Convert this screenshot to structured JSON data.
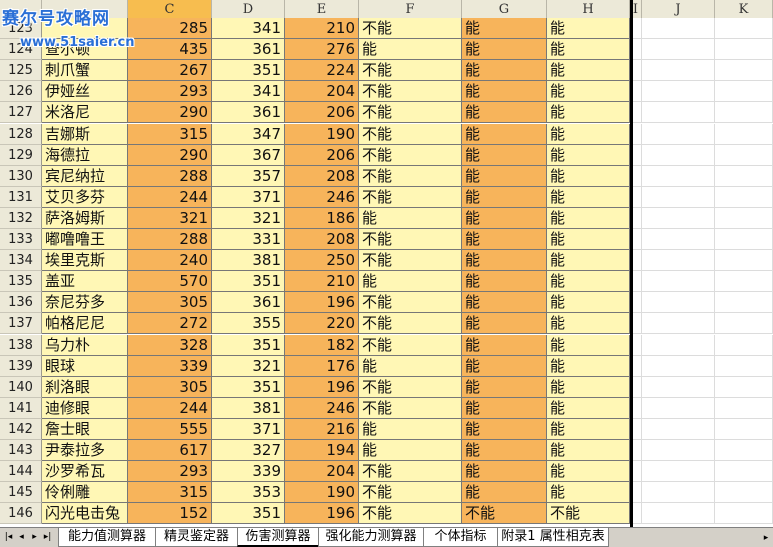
{
  "watermark": {
    "line1": "赛尔号攻略网",
    "line2": "www.51saier.cn"
  },
  "columns": [
    "C",
    "D",
    "E",
    "F",
    "G",
    "H",
    "I",
    "J",
    "K"
  ],
  "colors": {
    "name_col": "#fff7b5",
    "c_col": "#f7b45b",
    "d_col": "#fff7b5",
    "e_col": "#f7b45b",
    "f_col": "#fff7b5",
    "g_col": "#f7b45b",
    "h_col": "#fff7b5"
  },
  "rows": [
    {
      "num": "123",
      "name": "",
      "c": "285",
      "d": "341",
      "e": "210",
      "f": "不能",
      "g": "能",
      "h": "能"
    },
    {
      "num": "124",
      "name": "查尔顿",
      "c": "435",
      "d": "361",
      "e": "276",
      "f": "能",
      "g": "能",
      "h": "能"
    },
    {
      "num": "125",
      "name": "刺爪蟹",
      "c": "267",
      "d": "351",
      "e": "224",
      "f": "不能",
      "g": "能",
      "h": "能"
    },
    {
      "num": "126",
      "name": "伊娅丝",
      "c": "293",
      "d": "341",
      "e": "204",
      "f": "不能",
      "g": "能",
      "h": "能"
    },
    {
      "num": "127",
      "name": "米洛尼",
      "c": "290",
      "d": "361",
      "e": "206",
      "f": "不能",
      "g": "能",
      "h": "能"
    },
    {
      "num": "128",
      "name": "吉娜斯",
      "c": "315",
      "d": "347",
      "e": "190",
      "f": "不能",
      "g": "能",
      "h": "能"
    },
    {
      "num": "129",
      "name": "海德拉",
      "c": "290",
      "d": "367",
      "e": "206",
      "f": "不能",
      "g": "能",
      "h": "能"
    },
    {
      "num": "130",
      "name": "宾尼纳拉",
      "c": "288",
      "d": "357",
      "e": "208",
      "f": "不能",
      "g": "能",
      "h": "能"
    },
    {
      "num": "131",
      "name": "艾贝多芬",
      "c": "244",
      "d": "371",
      "e": "246",
      "f": "不能",
      "g": "能",
      "h": "能"
    },
    {
      "num": "132",
      "name": "萨洛姆斯",
      "c": "321",
      "d": "321",
      "e": "186",
      "f": "能",
      "g": "能",
      "h": "能"
    },
    {
      "num": "133",
      "name": "嘟噜噜王",
      "c": "288",
      "d": "331",
      "e": "208",
      "f": "不能",
      "g": "能",
      "h": "能"
    },
    {
      "num": "134",
      "name": "埃里克斯",
      "c": "240",
      "d": "381",
      "e": "250",
      "f": "不能",
      "g": "能",
      "h": "能"
    },
    {
      "num": "135",
      "name": "盖亚",
      "c": "570",
      "d": "351",
      "e": "210",
      "f": "能",
      "g": "能",
      "h": "能"
    },
    {
      "num": "136",
      "name": "奈尼芬多",
      "c": "305",
      "d": "361",
      "e": "196",
      "f": "不能",
      "g": "能",
      "h": "能"
    },
    {
      "num": "137",
      "name": "帕格尼尼",
      "c": "272",
      "d": "355",
      "e": "220",
      "f": "不能",
      "g": "能",
      "h": "能"
    },
    {
      "num": "138",
      "name": "乌力朴",
      "c": "328",
      "d": "351",
      "e": "182",
      "f": "不能",
      "g": "能",
      "h": "能"
    },
    {
      "num": "139",
      "name": "眼球",
      "c": "339",
      "d": "321",
      "e": "176",
      "f": "能",
      "g": "能",
      "h": "能"
    },
    {
      "num": "140",
      "name": "刹洛眼",
      "c": "305",
      "d": "351",
      "e": "196",
      "f": "不能",
      "g": "能",
      "h": "能"
    },
    {
      "num": "141",
      "name": "迪修眼",
      "c": "244",
      "d": "381",
      "e": "246",
      "f": "不能",
      "g": "能",
      "h": "能"
    },
    {
      "num": "142",
      "name": "詹士眼",
      "c": "555",
      "d": "371",
      "e": "216",
      "f": "能",
      "g": "能",
      "h": "能"
    },
    {
      "num": "143",
      "name": "尹泰拉多",
      "c": "617",
      "d": "327",
      "e": "194",
      "f": "能",
      "g": "能",
      "h": "能"
    },
    {
      "num": "144",
      "name": "沙罗希瓦",
      "c": "293",
      "d": "339",
      "e": "204",
      "f": "不能",
      "g": "能",
      "h": "能"
    },
    {
      "num": "145",
      "name": "伶俐雕",
      "c": "315",
      "d": "353",
      "e": "190",
      "f": "不能",
      "g": "能",
      "h": "能"
    },
    {
      "num": "146",
      "name": "闪光电击兔",
      "c": "152",
      "d": "351",
      "e": "196",
      "f": "不能",
      "g": "不能",
      "h": "不能"
    }
  ],
  "nav_buttons": [
    "|◂",
    "◂",
    "▸",
    "▸|"
  ],
  "tabs": [
    {
      "label": "能力值测算器",
      "active": false
    },
    {
      "label": "精灵鉴定器",
      "active": false
    },
    {
      "label": "伤害测算器",
      "active": true
    },
    {
      "label": "强化能力测算器",
      "active": false
    },
    {
      "label": "个体指标",
      "active": false
    },
    {
      "label": "附录1 属性相克表",
      "active": false
    }
  ],
  "scroll_right": "▸"
}
